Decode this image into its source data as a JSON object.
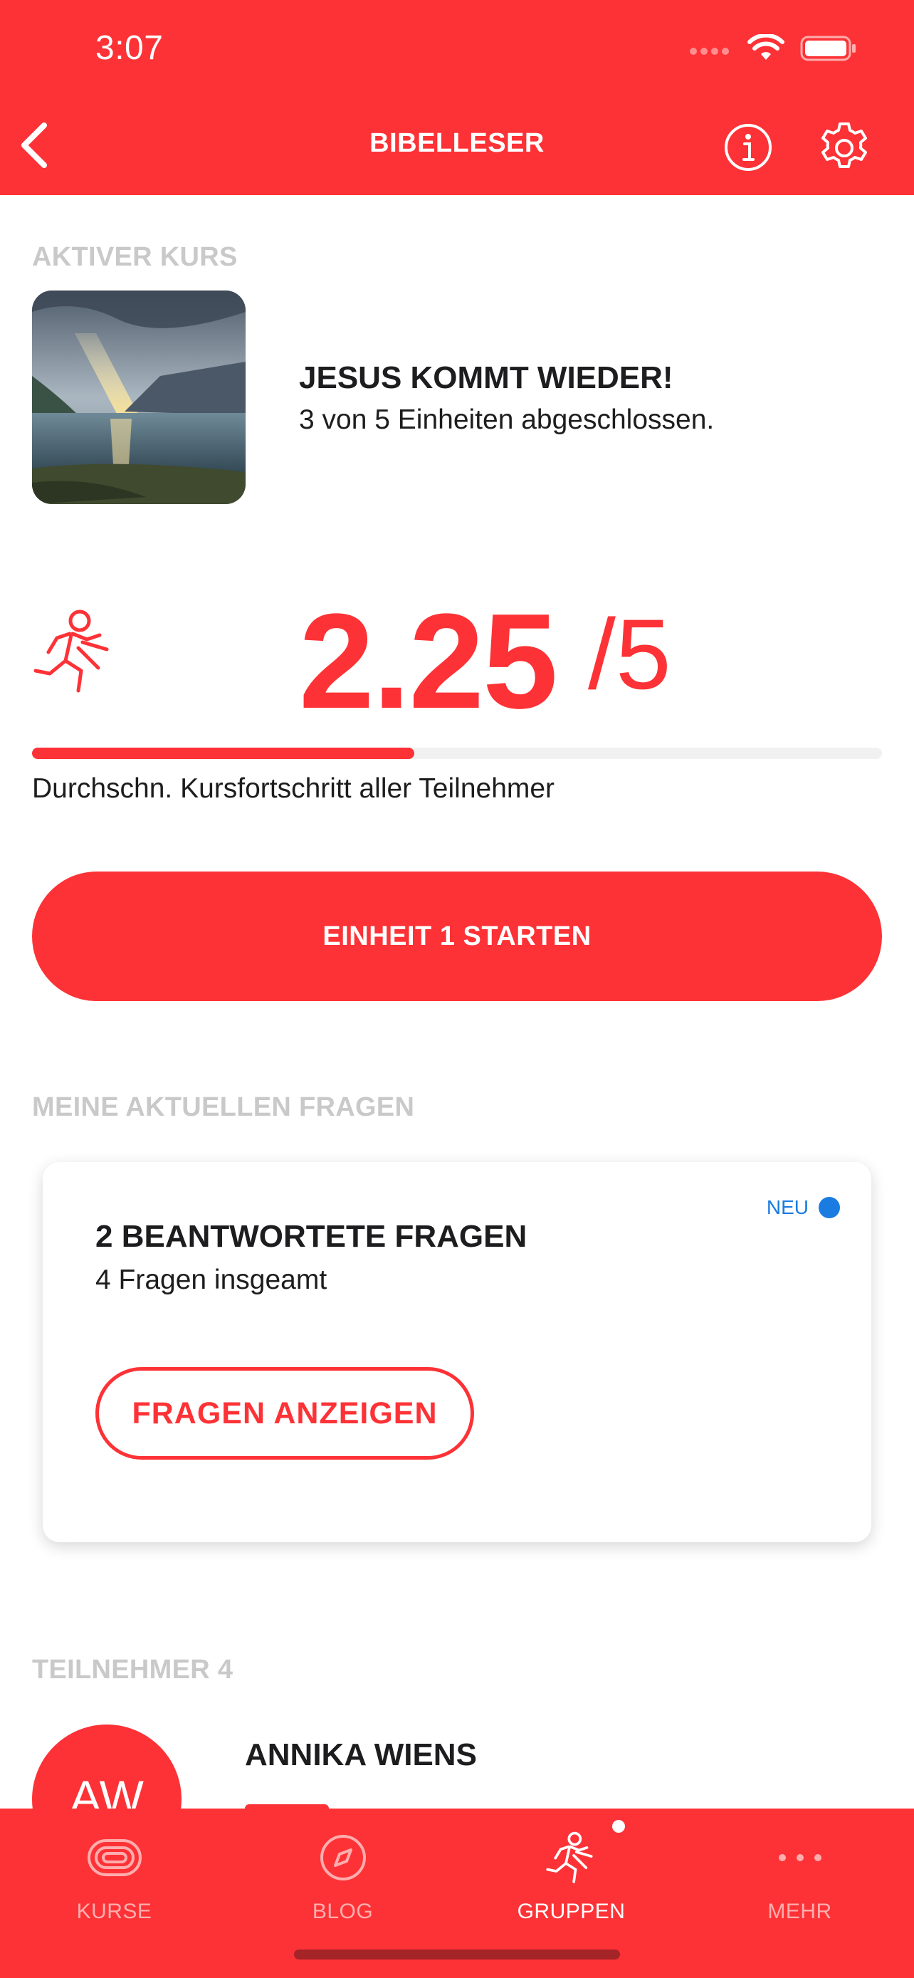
{
  "status_bar": {
    "time": "3:07"
  },
  "nav": {
    "title": "BIBELLESER"
  },
  "active_course": {
    "section_label": "AKTIVER KURS",
    "title": "JESUS KOMMT WIEDER!",
    "subtitle": "3 von 5 Einheiten abgeschlossen."
  },
  "progress": {
    "score": "2.25",
    "max": "/5",
    "fraction": 0.45,
    "caption": "Durchschn. Kursfortschritt aller Teilnehmer"
  },
  "start_button": {
    "label": "EINHEIT 1 STARTEN"
  },
  "questions": {
    "section_label": "MEINE AKTUELLEN FRAGEN",
    "badge": "NEU",
    "title": "2 BEANTWORTETE FRAGEN",
    "subtitle": "4 Fragen insgeamt",
    "button_label": "FRAGEN ANZEIGEN"
  },
  "participants": {
    "section_label": "TEILNEHMER 4",
    "items": [
      {
        "initials": "AW",
        "name": "ANNIKA WIENS"
      }
    ]
  },
  "tabbar": {
    "items": [
      {
        "label": "KURSE",
        "icon": "track-icon"
      },
      {
        "label": "BLOG",
        "icon": "compass-icon"
      },
      {
        "label": "GRUPPEN",
        "icon": "runner-icon"
      },
      {
        "label": "MEHR",
        "icon": "more-icon"
      }
    ],
    "active": "GRUPPEN"
  },
  "colors": {
    "accent": "#fd3236",
    "badge": "#1a7be0"
  }
}
